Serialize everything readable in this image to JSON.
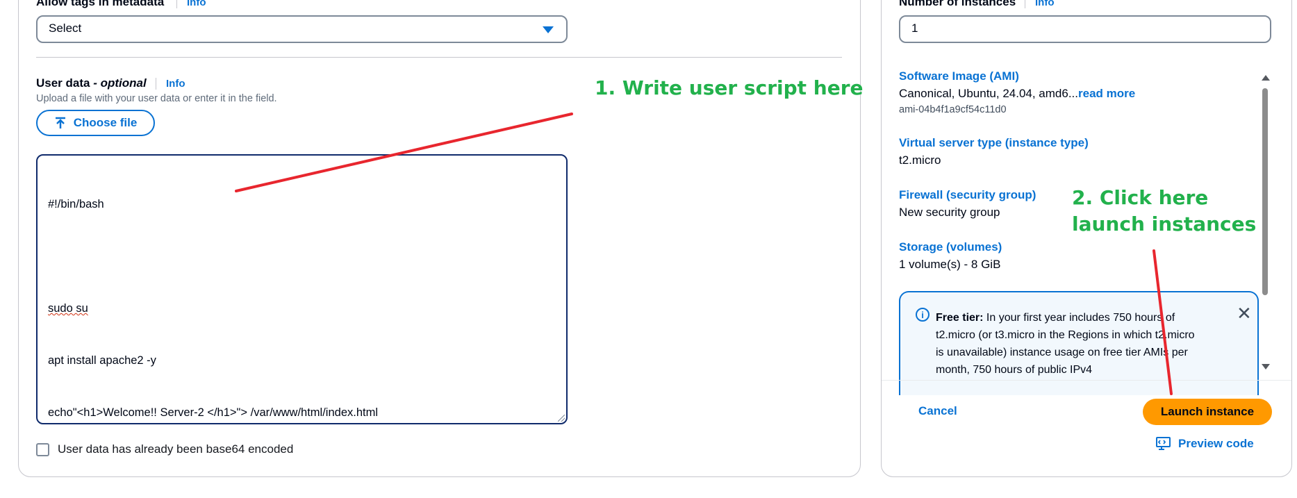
{
  "left_panel": {
    "metadata_tags_label": "Allow tags in metadata",
    "metadata_tags_info": "Info",
    "metadata_tags_select": "Select",
    "user_data_label": "User data",
    "user_data_optional": "- optional",
    "user_data_info": "Info",
    "user_data_description": "Upload a file with your user data or enter it in the field.",
    "choose_file_label": "Choose file",
    "user_data_lines": [
      "#!/bin/bash",
      "",
      "sudo su",
      "apt install apache2 -y",
      "echo\"<h1>Welcome!! Server-2 </h1>\"> /var/www/html/index.html"
    ],
    "base64_checkbox_label": "User data has already been base64 encoded"
  },
  "right_panel": {
    "instances_label": "Number of instances",
    "instances_info": "Info",
    "instances_value": "1",
    "summary": {
      "ami_title": "Software Image (AMI)",
      "ami_value": "Canonical, Ubuntu, 24.04, amd6...",
      "ami_read_more": "read more",
      "ami_id": "ami-04b4f1a9cf54c11d0",
      "instance_type_title": "Virtual server type (instance type)",
      "instance_type_value": "t2.micro",
      "firewall_title": "Firewall (security group)",
      "firewall_value": "New security group",
      "storage_title": "Storage (volumes)",
      "storage_value": "1 volume(s) - 8 GiB"
    },
    "free_tier": {
      "title": "Free tier:",
      "text": "In your first year includes 750 hours of t2.micro (or t3.micro in the Regions in which t2.micro is unavailable) instance usage on free tier AMIs per month, 750 hours of public IPv4"
    },
    "cancel_label": "Cancel",
    "launch_label": "Launch instance",
    "preview_label": "Preview code"
  },
  "annotations": {
    "step1": "1. Write user script here",
    "step2_line1": "2. Click here",
    "step2_line2": "launch instances"
  },
  "colors": {
    "link_blue": "#0972d3",
    "launch_orange": "#ff9900",
    "annotation_green": "#22b14c",
    "annotation_arrow_red": "#e8262e"
  },
  "icons": [
    "caret-down-icon",
    "upload-icon",
    "info-icon",
    "close-icon",
    "preview-code-icon"
  ]
}
